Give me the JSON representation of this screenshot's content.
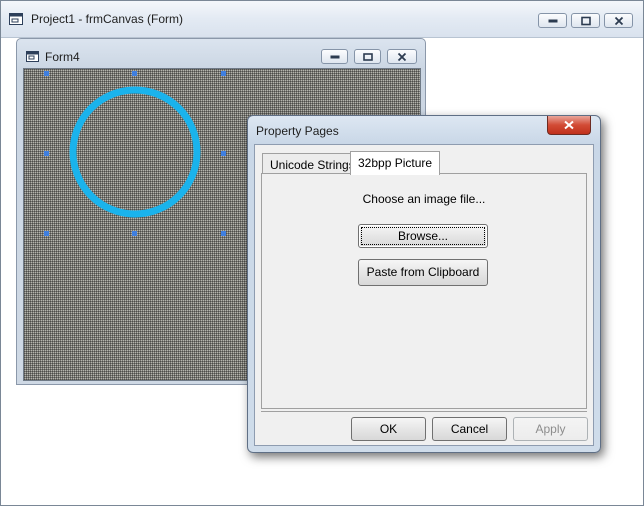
{
  "outer_window": {
    "title": "Project1 - frmCanvas (Form)"
  },
  "form4": {
    "title": "Form4"
  },
  "dialog": {
    "title": "Property Pages",
    "tabs": [
      {
        "label": "Unicode Strings",
        "active": false
      },
      {
        "label": "32bpp Picture",
        "active": true
      }
    ],
    "prompt": "Choose an image file...",
    "browse_label": "Browse...",
    "paste_label": "Paste from Clipboard",
    "ok_label": "OK",
    "cancel_label": "Cancel",
    "apply_label": "Apply"
  },
  "colors": {
    "ring": "#1ab3ec",
    "selection_handle": "#3f7fe0",
    "close_button": "#c0301c"
  }
}
